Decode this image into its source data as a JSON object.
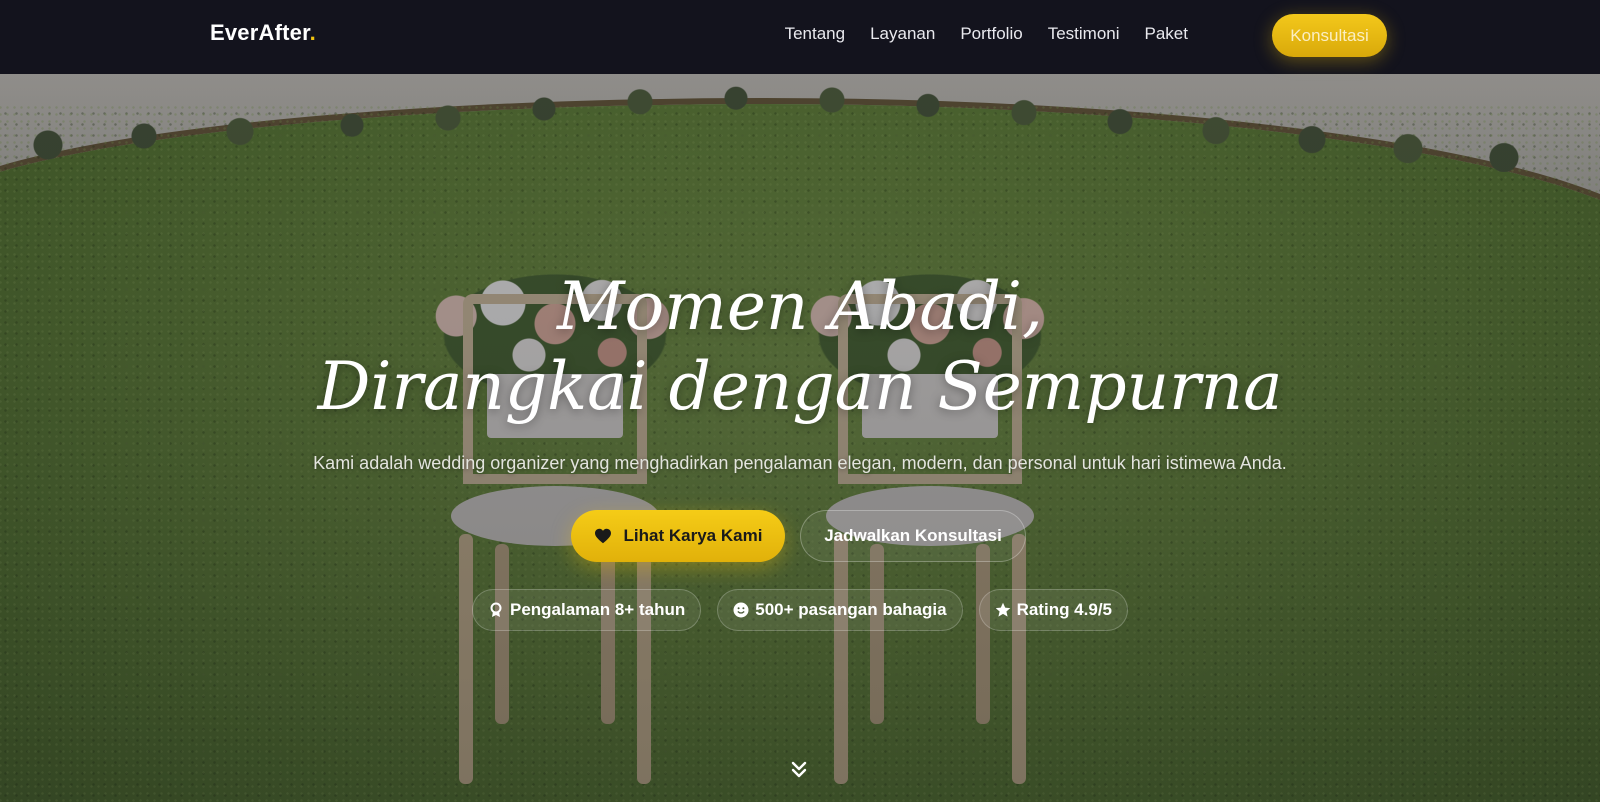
{
  "brand": {
    "name": "EverAfter",
    "dot": "."
  },
  "nav": {
    "links": [
      "Tentang",
      "Layanan",
      "Portfolio",
      "Testimoni",
      "Paket"
    ],
    "cta": "Konsultasi"
  },
  "hero": {
    "title_line1": "Momen Abadi,",
    "title_line2": "Dirangkai dengan Sempurna",
    "subtitle": "Kami adalah wedding organizer yang menghadirkan pengalaman elegan, modern, dan personal untuk hari istimewa Anda.",
    "primary_button": "Lihat Karya Kami",
    "secondary_button": "Jadwalkan Konsultasi",
    "badges": [
      {
        "icon": "award-icon",
        "label": "Pengalaman 8+ tahun"
      },
      {
        "icon": "smile-icon",
        "label": "500+ pasangan bahagia"
      },
      {
        "icon": "star-icon",
        "label": "Rating 4.9/5"
      }
    ],
    "scroll_icon": "chevrons-down-icon"
  },
  "colors": {
    "nav_bg": "#13131d",
    "accent": "#f1c40f",
    "text": "#ffffff"
  }
}
